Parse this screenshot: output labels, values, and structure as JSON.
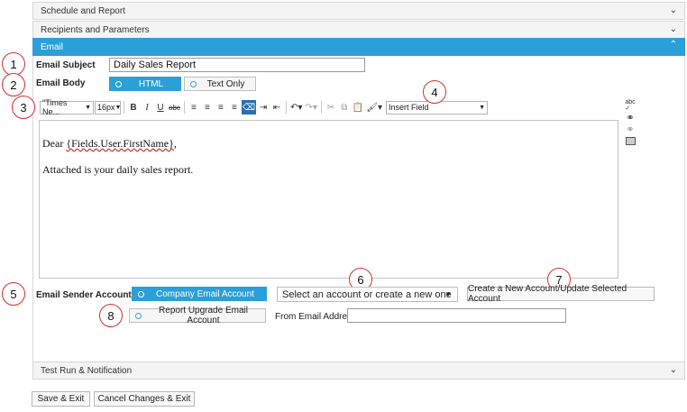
{
  "sections": {
    "schedule": "Schedule and Report",
    "recipients": "Recipients and Parameters",
    "email": "Email",
    "test_run": "Test Run & Notification"
  },
  "callouts": [
    "1",
    "2",
    "3",
    "4",
    "5",
    "6",
    "7",
    "8"
  ],
  "email_subject": {
    "label": "Email Subject",
    "value": "Daily Sales Report"
  },
  "email_body": {
    "label": "Email Body",
    "options": [
      "HTML",
      "Text Only"
    ],
    "selected": "HTML"
  },
  "toolbar": {
    "font_family": "\"Times Ne...",
    "font_size": "16px",
    "insert_field": "Insert Field"
  },
  "editor": {
    "greeting": "Dear ",
    "field": "{Fields.User.FirstName}",
    "greeting_end": ",",
    "line2": "Attached is your daily sales report."
  },
  "sender": {
    "label": "Email Sender Account",
    "company_option": "Company Email Account",
    "upgrade_option": "Report Upgrade Email Account",
    "account_select": "Select an account or create a new one",
    "create_button": "Create a New Account/Update Selected Account",
    "from_label": "From Email Address",
    "from_value": ""
  },
  "footer": {
    "save": "Save & Exit",
    "cancel": "Cancel Changes & Exit"
  },
  "colors": {
    "accent": "#2b9fd8",
    "callout_border": "#d33030"
  }
}
